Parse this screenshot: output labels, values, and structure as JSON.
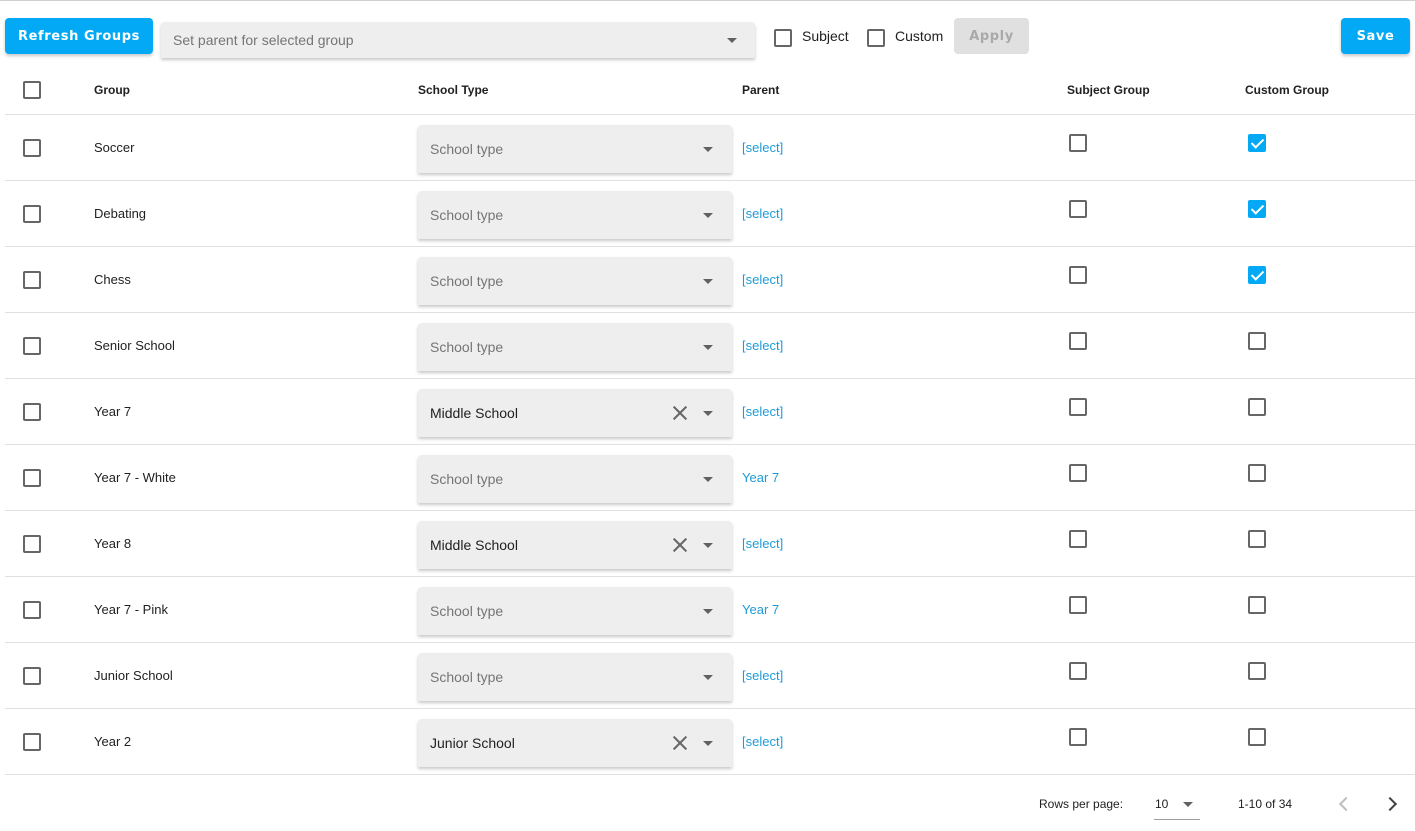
{
  "toolbar": {
    "refresh_label": "Refresh Groups",
    "parent_select_placeholder": "Set parent for selected group",
    "subject_label": "Subject",
    "custom_label": "Custom",
    "apply_label": "Apply",
    "save_label": "Save"
  },
  "table": {
    "headers": {
      "group": "Group",
      "school_type": "School Type",
      "parent": "Parent",
      "subject_group": "Subject Group",
      "custom_group": "Custom Group"
    },
    "school_type_placeholder": "School type",
    "rows": [
      {
        "group": "Soccer",
        "school_type": "",
        "parent": "[select]",
        "subject": false,
        "custom": true
      },
      {
        "group": "Debating",
        "school_type": "",
        "parent": "[select]",
        "subject": false,
        "custom": true
      },
      {
        "group": "Chess",
        "school_type": "",
        "parent": "[select]",
        "subject": false,
        "custom": true
      },
      {
        "group": "Senior School",
        "school_type": "",
        "parent": "[select]",
        "subject": false,
        "custom": false
      },
      {
        "group": "Year 7",
        "school_type": "Middle School",
        "parent": "[select]",
        "subject": false,
        "custom": false
      },
      {
        "group": "Year 7 - White",
        "school_type": "",
        "parent": "Year 7",
        "subject": false,
        "custom": false
      },
      {
        "group": "Year 8",
        "school_type": "Middle School",
        "parent": "[select]",
        "subject": false,
        "custom": false
      },
      {
        "group": "Year 7 - Pink",
        "school_type": "",
        "parent": "Year 7",
        "subject": false,
        "custom": false
      },
      {
        "group": "Junior School",
        "school_type": "",
        "parent": "[select]",
        "subject": false,
        "custom": false
      },
      {
        "group": "Year 2",
        "school_type": "Junior School",
        "parent": "[select]",
        "subject": false,
        "custom": false
      }
    ]
  },
  "pagination": {
    "rows_per_page_label": "Rows per page:",
    "rows_per_page": "10",
    "range": "1-10 of 34"
  },
  "colors": {
    "accent": "#03a9f4",
    "link": "#1e9bd7"
  }
}
